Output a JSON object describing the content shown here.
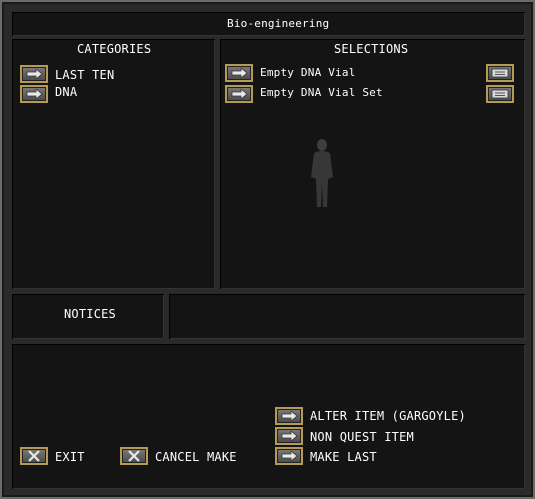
{
  "window": {
    "title": "Bio-engineering"
  },
  "categories": {
    "header": "CATEGORIES",
    "items": [
      {
        "label": "LAST TEN"
      },
      {
        "label": "DNA"
      }
    ]
  },
  "selections": {
    "header": "SELECTIONS",
    "items": [
      {
        "label": "Empty DNA Vial"
      },
      {
        "label": "Empty DNA Vial Set"
      }
    ]
  },
  "notices": {
    "header": "NOTICES"
  },
  "actions": {
    "exit": "EXIT",
    "cancel_make": "CANCEL MAKE",
    "alter_item": "ALTER ITEM (GARGOYLE)",
    "non_quest_item": "NON QUEST ITEM",
    "make_last": "MAKE LAST"
  },
  "colors": {
    "frame": "#2a2a2a",
    "panel": "#141414",
    "button_border": "#b49a52",
    "text": "#ffffff"
  },
  "icons": {
    "arrow_button": "arrow-right-icon",
    "info_button": "scroll-info-icon",
    "x_button": "x-icon"
  }
}
